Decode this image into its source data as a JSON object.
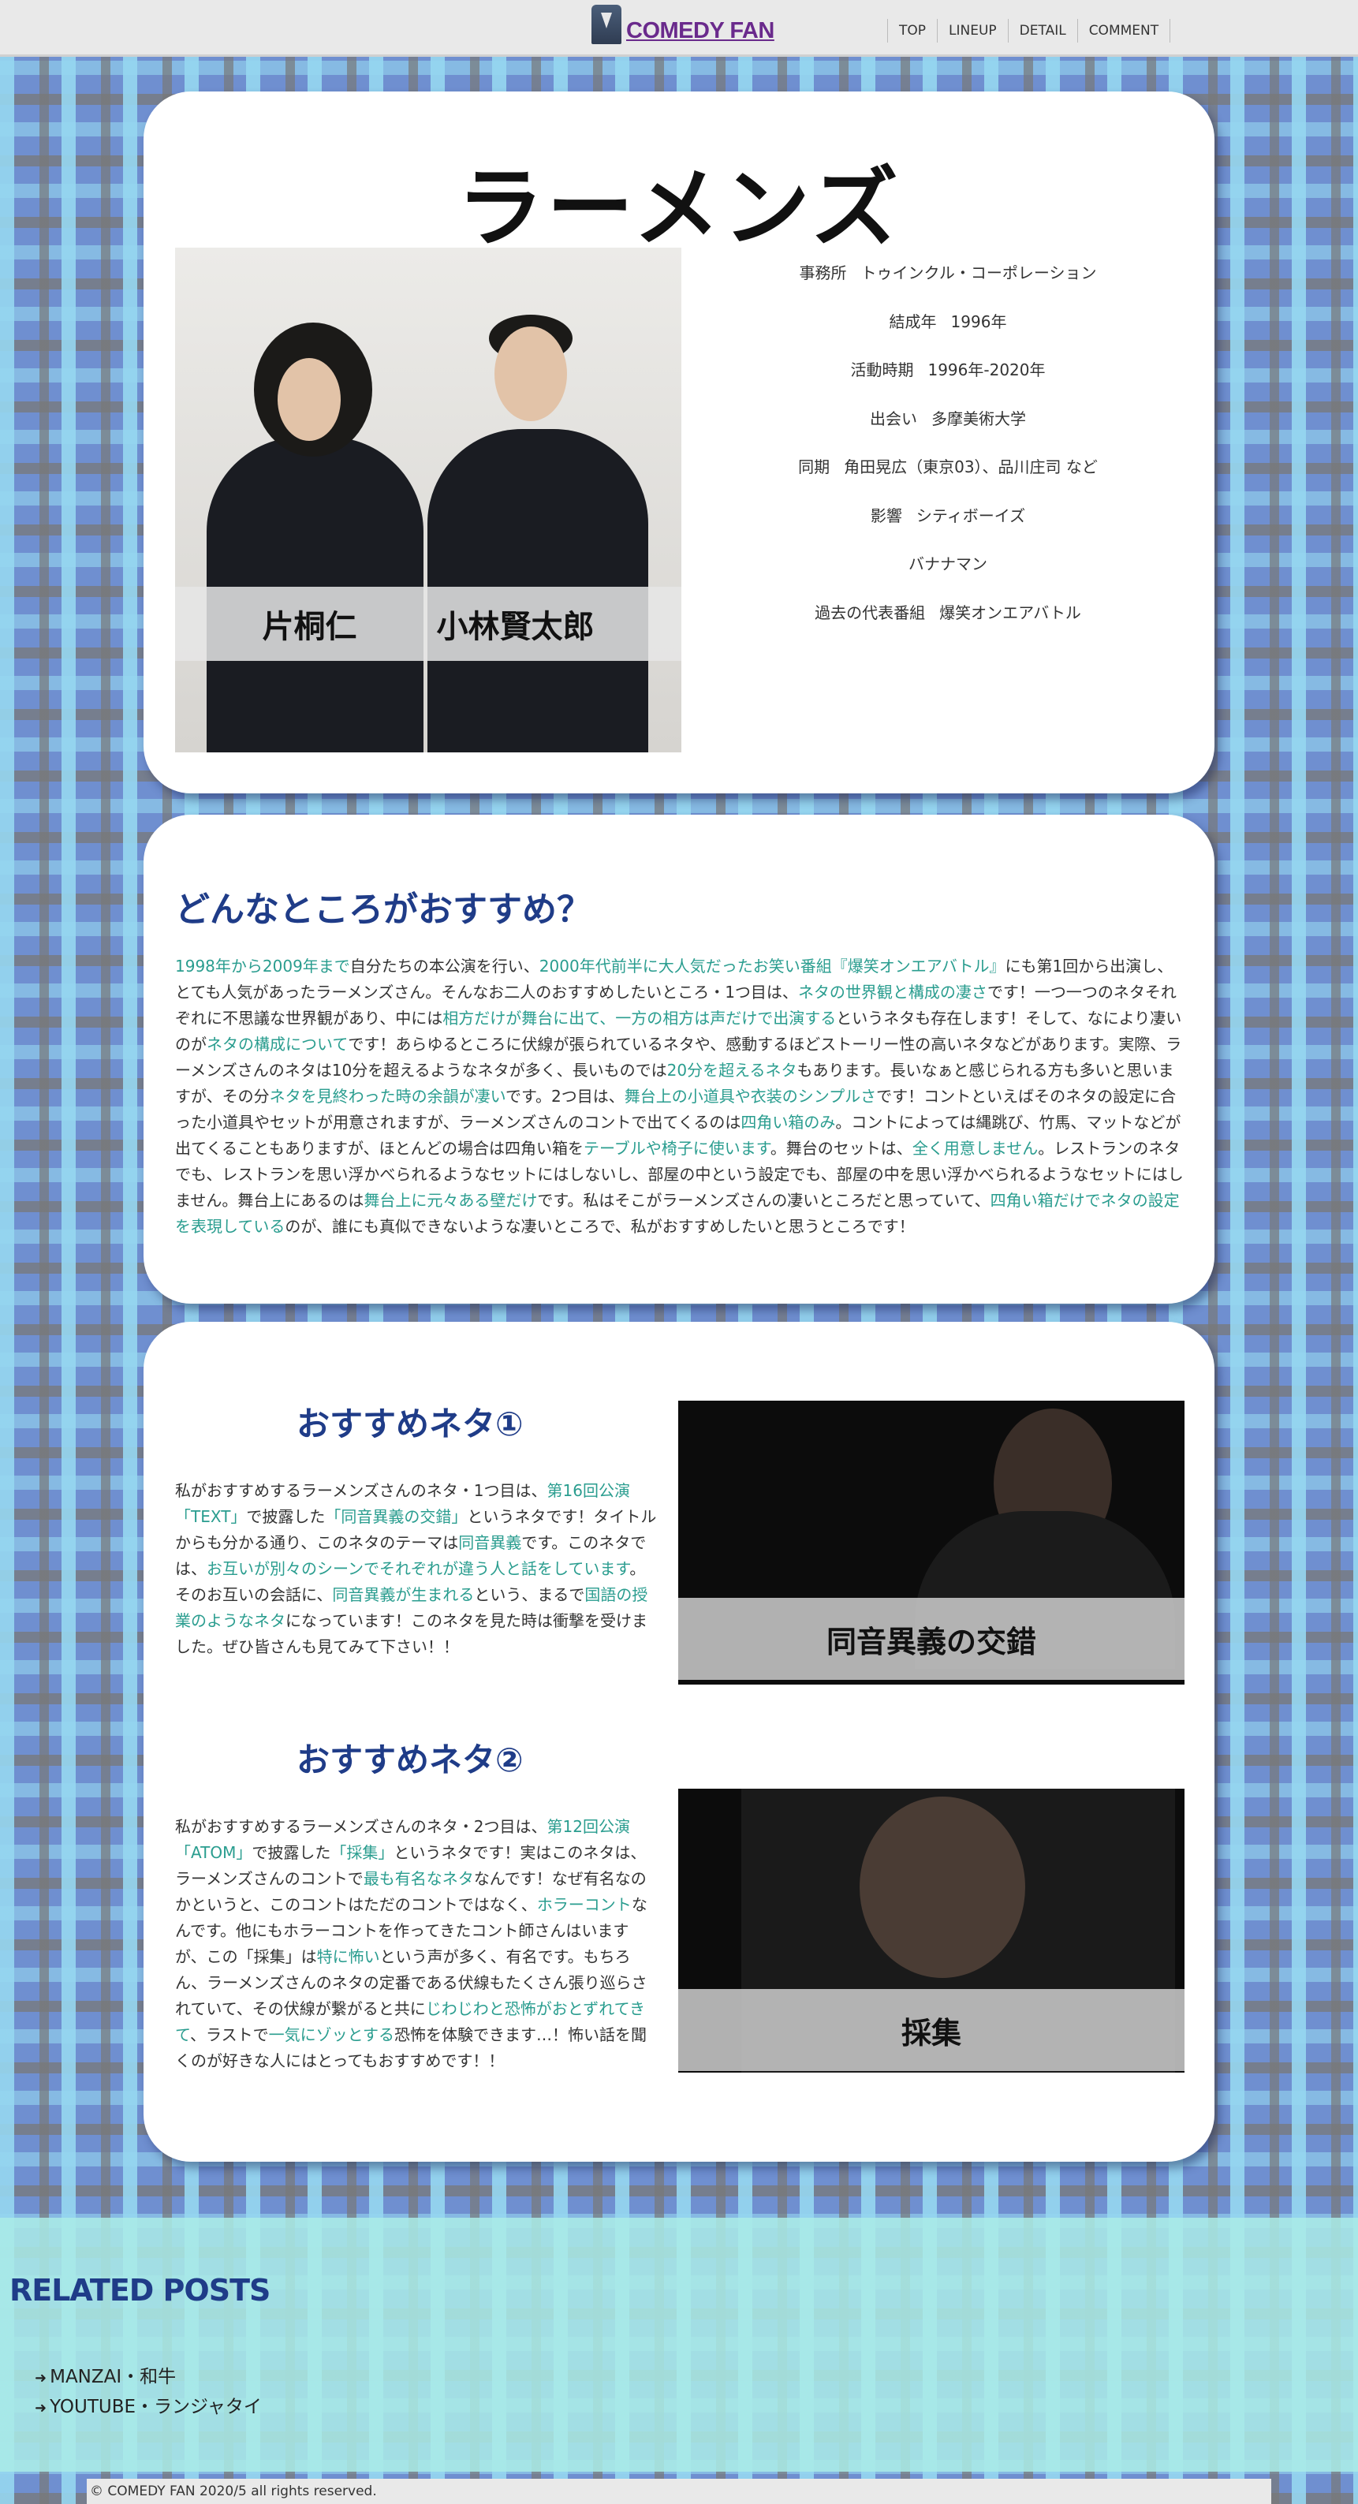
{
  "header": {
    "logo_text": "COMEDY FAN",
    "nav": [
      "TOP",
      "LINEUP",
      "DETAIL",
      "COMMENT"
    ]
  },
  "profile_card": {
    "group_name": "ラーメンズ",
    "members": [
      "片桐仁",
      "小林賢太郎"
    ],
    "rows": [
      {
        "key": "事務所",
        "value": "トゥインクル・コーポレーション"
      },
      {
        "key": "結成年",
        "value": "1996年"
      },
      {
        "key": "活動時期",
        "value": "1996年-2020年"
      },
      {
        "key": "出会い",
        "value": "多摩美術大学"
      },
      {
        "key": "同期",
        "value": "角田晃広（東京03）、品川庄司 など"
      },
      {
        "key": "影響",
        "value": "シティボーイズ"
      },
      {
        "key": "",
        "value": "バナナマン"
      },
      {
        "key": "過去の代表番組",
        "value": "爆笑オンエアバトル"
      }
    ]
  },
  "recommend": {
    "title": "どんなところがおすすめ？",
    "segments": [
      {
        "t": "1998年から2009年まで",
        "hl": true
      },
      {
        "t": "自分たちの本公演を行い、",
        "hl": false
      },
      {
        "t": "2000年代前半に大人気だったお笑い番組『爆笑オンエアバトル』",
        "hl": true
      },
      {
        "t": "にも第1回から出演し、とても人気があったラーメンズさん。そんなお二人のおすすめしたいところ・1つ目は、",
        "hl": false
      },
      {
        "t": "ネタの世界観と構成の凄さ",
        "hl": true
      },
      {
        "t": "です！一つ一つのネタそれぞれに不思議な世界観があり、中には",
        "hl": false
      },
      {
        "t": "相方だけが舞台に出て、一方の相方は声だけで出演する",
        "hl": true
      },
      {
        "t": "というネタも存在します！そして、なにより凄いのが",
        "hl": false
      },
      {
        "t": "ネタの構成について",
        "hl": true
      },
      {
        "t": "です！あらゆるところに伏線が張られているネタや、感動するほどストーリー性の高いネタなどがあります。実際、ラーメンズさんのネタは10分を超えるようなネタが多く、長いものでは",
        "hl": false
      },
      {
        "t": "20分を超えるネタ",
        "hl": true
      },
      {
        "t": "もあります。長いなぁと感じられる方も多いと思いますが、その分",
        "hl": false
      },
      {
        "t": "ネタを見終わった時の余韻が凄い",
        "hl": true
      },
      {
        "t": "です。2つ目は、",
        "hl": false
      },
      {
        "t": "舞台上の小道具や衣装のシンプルさ",
        "hl": true
      },
      {
        "t": "です！コントといえばそのネタの設定に合った小道具やセットが用意されますが、ラーメンズさんのコントで出てくるのは",
        "hl": false
      },
      {
        "t": "四角い箱のみ",
        "hl": true
      },
      {
        "t": "。コントによっては縄跳び、竹馬、マットなどが出てくることもありますが、ほとんどの場合は四角い箱を",
        "hl": false
      },
      {
        "t": "テーブルや椅子に使います",
        "hl": true
      },
      {
        "t": "。舞台のセットは、",
        "hl": false
      },
      {
        "t": "全く用意しません",
        "hl": true
      },
      {
        "t": "。レストランのネタでも、レストランを思い浮かべられるようなセットにはしないし、部屋の中という設定でも、部屋の中を思い浮かべられるようなセットにはしません。舞台上にあるのは",
        "hl": false
      },
      {
        "t": "舞台上に元々ある壁だけ",
        "hl": true
      },
      {
        "t": "です。私はそこがラーメンズさんの凄いところだと思っていて、",
        "hl": false
      },
      {
        "t": "四角い箱だけでネタの設定を表現している",
        "hl": true
      },
      {
        "t": "のが、誰にも真似できないような凄いところで、私がおすすめしたいと思うところです！",
        "hl": false
      }
    ]
  },
  "neta": [
    {
      "title": "おすすめネタ①",
      "image_caption": "同音異義の交錯",
      "segments": [
        {
          "t": "私がおすすめするラーメンズさんのネタ・1つ目は、",
          "hl": false
        },
        {
          "t": "第16回公演「TEXT」",
          "hl": true
        },
        {
          "t": "で披露した",
          "hl": false
        },
        {
          "t": "「同音異義の交錯」",
          "hl": true
        },
        {
          "t": "というネタです！タイトルからも分かる通り、このネタのテーマは",
          "hl": false
        },
        {
          "t": "同音異義",
          "hl": true
        },
        {
          "t": "です。このネタでは、",
          "hl": false
        },
        {
          "t": "お互いが別々のシーンでそれぞれが違う人と話をしています",
          "hl": true
        },
        {
          "t": "。そのお互いの会話に、",
          "hl": false
        },
        {
          "t": "同音異義が生まれる",
          "hl": true
        },
        {
          "t": "という、まるで",
          "hl": false
        },
        {
          "t": "国語の授業のようなネタ",
          "hl": true
        },
        {
          "t": "になっています！このネタを見た時は衝撃を受けました。ぜひ皆さんも見てみて下さい！！",
          "hl": false
        }
      ]
    },
    {
      "title": "おすすめネタ②",
      "image_caption": "採集",
      "segments": [
        {
          "t": "私がおすすめするラーメンズさんのネタ・2つ目は、",
          "hl": false
        },
        {
          "t": "第12回公演「ATOM」",
          "hl": true
        },
        {
          "t": "で披露した",
          "hl": false
        },
        {
          "t": "「採集」",
          "hl": true
        },
        {
          "t": "というネタです！実はこのネタは、ラーメンズさんのコントで",
          "hl": false
        },
        {
          "t": "最も有名なネタ",
          "hl": true
        },
        {
          "t": "なんです！なぜ有名なのかというと、このコントはただのコントではなく、",
          "hl": false
        },
        {
          "t": "ホラーコント",
          "hl": true
        },
        {
          "t": "なんです。他にもホラーコントを作ってきたコント師さんはいますが、この「採集」は",
          "hl": false
        },
        {
          "t": "特に怖い",
          "hl": true
        },
        {
          "t": "という声が多く、有名です。もちろん、ラーメンズさんのネタの定番である伏線もたくさん張り巡らされていて、その伏線が繋がると共に",
          "hl": false
        },
        {
          "t": "じわじわと恐怖がおとずれてきて",
          "hl": true
        },
        {
          "t": "、ラストで",
          "hl": false
        },
        {
          "t": "一気にゾッとする",
          "hl": true
        },
        {
          "t": "恐怖を体験できます…！怖い話を聞くのが好きな人にはとってもおすすめです！！",
          "hl": false
        }
      ]
    }
  ],
  "related": {
    "title": "RELATED POSTS",
    "items": [
      "MANZAI・和牛",
      "YOUTUBE・ランジャタイ"
    ]
  },
  "footer": {
    "copyright": "© COMEDY FAN 2020/5 all rights reserved."
  },
  "colors": {
    "accent_navy": "#1f3c88",
    "highlight_teal": "#2a9d8f",
    "logo_purple": "#6a2a8c"
  }
}
